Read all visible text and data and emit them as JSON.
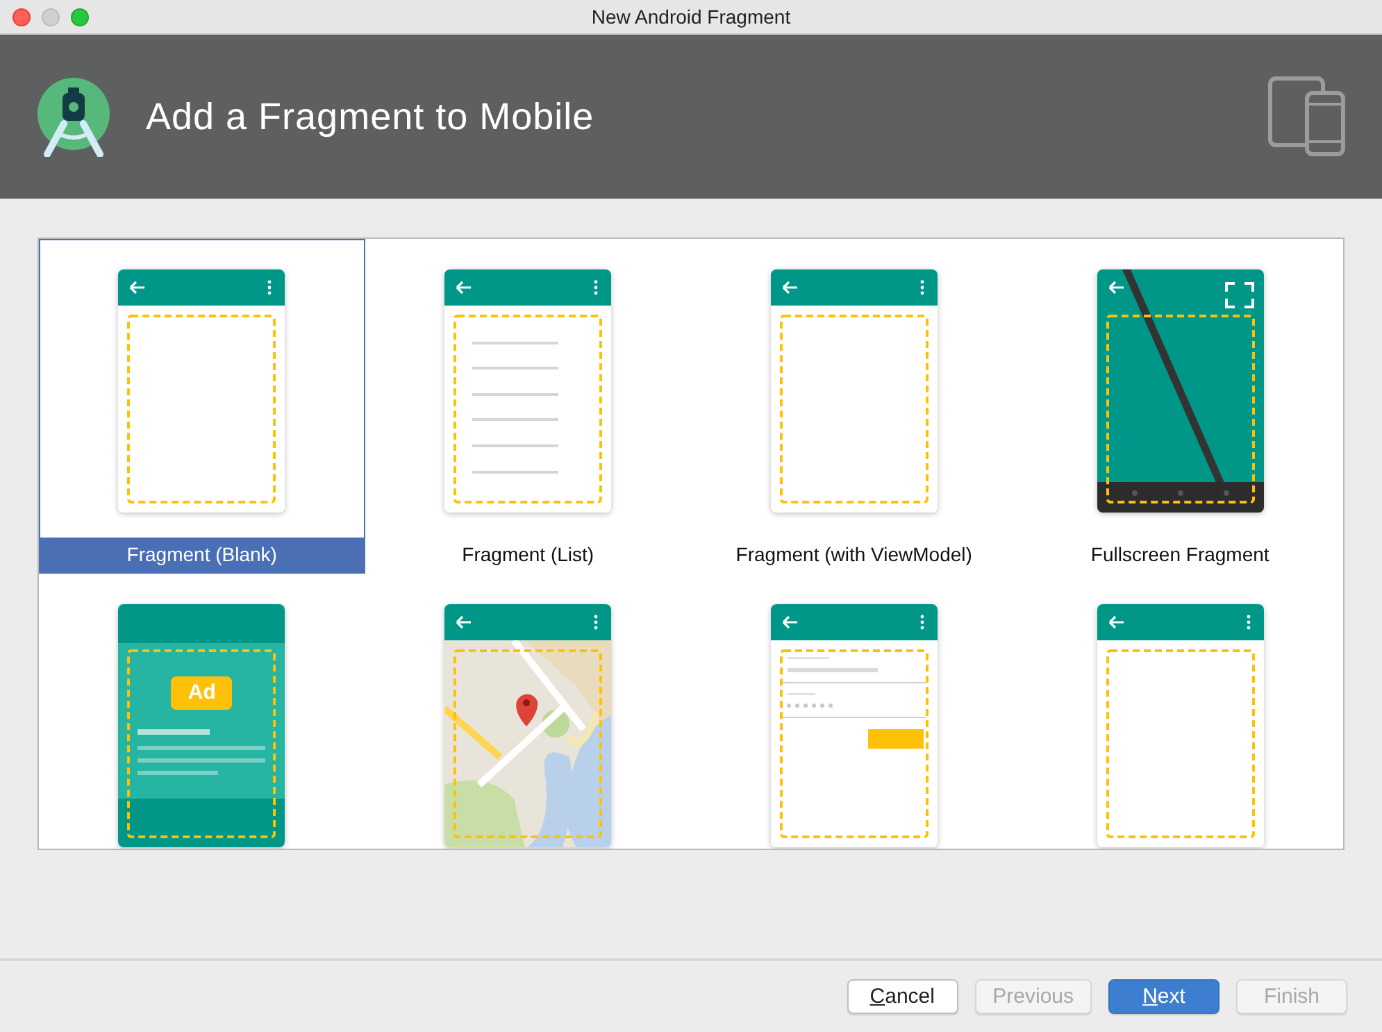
{
  "window": {
    "title": "New Android Fragment"
  },
  "header": {
    "title": "Add a Fragment to Mobile"
  },
  "gallery": {
    "items": [
      {
        "kind": "blank",
        "label": "Fragment (Blank)",
        "selected": true
      },
      {
        "kind": "list",
        "label": "Fragment (List)",
        "selected": false
      },
      {
        "kind": "blank",
        "label": "Fragment (with ViewModel)",
        "selected": false
      },
      {
        "kind": "fullscreen",
        "label": "Fullscreen Fragment",
        "selected": false
      },
      {
        "kind": "ad",
        "badge": "Ad",
        "selected": false
      },
      {
        "kind": "map",
        "selected": false
      },
      {
        "kind": "login",
        "selected": false
      },
      {
        "kind": "blank",
        "selected": false
      }
    ]
  },
  "buttons": [
    {
      "mnemonic": "C",
      "text": "ancel",
      "disabled": false,
      "default": false
    },
    {
      "text": "Previous",
      "disabled": true,
      "default": false
    },
    {
      "mnemonic": "N",
      "text": "ext",
      "disabled": false,
      "default": true
    },
    {
      "text": "Finish",
      "disabled": true,
      "default": false
    }
  ]
}
